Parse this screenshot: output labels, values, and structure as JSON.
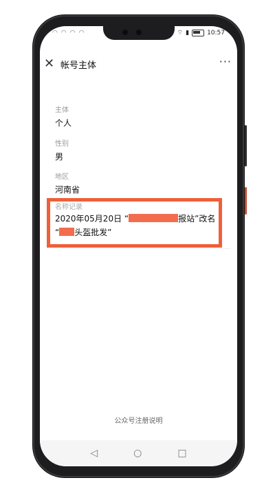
{
  "status_bar": {
    "time": "10:57",
    "left_icons": [
      "wifi-icon",
      "signal-icon",
      "signal-icon",
      "status-icon"
    ]
  },
  "header": {
    "title": "帐号主体",
    "back_icon": "close-icon",
    "more_icon": "more-icon"
  },
  "fields": [
    {
      "label": "主体",
      "value": "个人"
    },
    {
      "label": "性别",
      "value": "男"
    },
    {
      "label": "地区",
      "value": "河南省"
    }
  ],
  "record": {
    "label": "名称记录",
    "line1_prefix": "2020年05月20日 “",
    "line1_suffix": "报站”改名",
    "line2_prefix": "“",
    "line2_suffix": "头盔批发”"
  },
  "footer": {
    "link": "公众号注册说明"
  },
  "system_nav": {
    "back": "◁",
    "home": "○",
    "recent": "□"
  },
  "colors": {
    "highlight": "#ef5f3a"
  }
}
